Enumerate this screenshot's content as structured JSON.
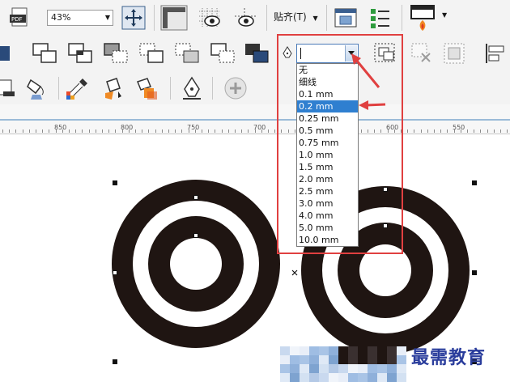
{
  "toolbar": {
    "zoom_value": "43%",
    "snap_label": "贴齐(T)"
  },
  "outline_width": {
    "current_value": "",
    "options": [
      "无",
      "细线",
      "0.1 mm",
      "0.2 mm",
      "0.25 mm",
      "0.5 mm",
      "0.75 mm",
      "1.0 mm",
      "1.5 mm",
      "2.0 mm",
      "2.5 mm",
      "3.0 mm",
      "4.0 mm",
      "5.0 mm",
      "10.0 mm"
    ],
    "selected_option": "0.2 mm"
  },
  "ruler": {
    "labels": [
      "850",
      "800",
      "750",
      "700",
      "600",
      "550"
    ]
  },
  "watermark": {
    "text": "最需教育"
  },
  "colors": {
    "highlight": "#2f7fd0",
    "annotation_red": "#e04040",
    "ring_fill": "#1f1512",
    "watermark": "#2a3d9c"
  },
  "icons": [
    "pdf-icon",
    "fit-page-icon",
    "rulers-icon",
    "grid-icon",
    "guidelines-icon",
    "snap-icon",
    "options-icon",
    "checklist-icon",
    "launch-icon",
    "outline-pen-icon",
    "add-icon"
  ]
}
